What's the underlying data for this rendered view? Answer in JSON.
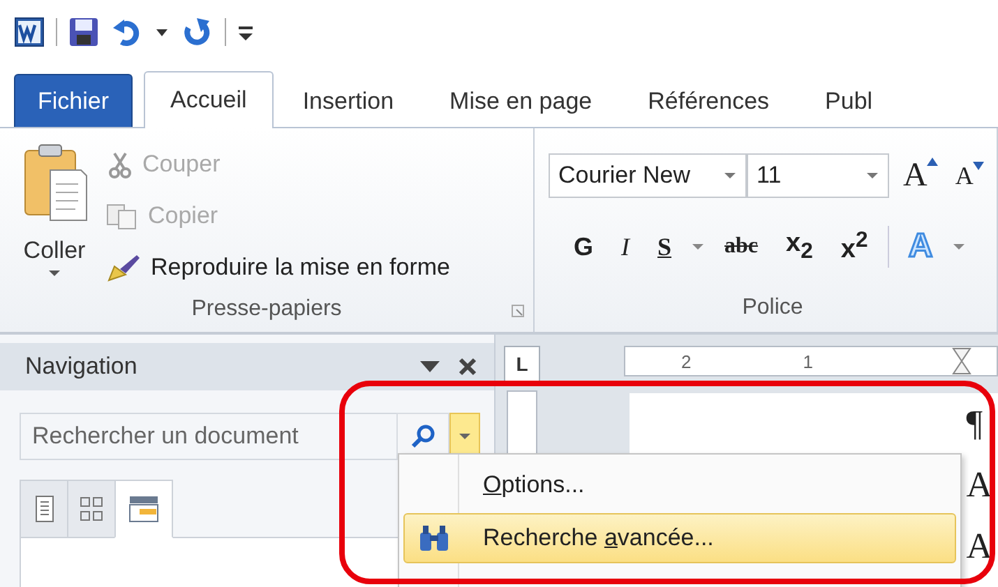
{
  "tabs": [
    {
      "label": "Fichier",
      "kind": "file",
      "selected": false
    },
    {
      "label": "Accueil",
      "kind": "tab",
      "selected": true
    },
    {
      "label": "Insertion",
      "kind": "tab",
      "selected": false
    },
    {
      "label": "Mise en page",
      "kind": "tab",
      "selected": false
    },
    {
      "label": "Références",
      "kind": "tab",
      "selected": false
    },
    {
      "label": "Publ",
      "kind": "tab",
      "selected": false
    }
  ],
  "clipboard": {
    "paste": "Coller",
    "cut": {
      "label": "Couper",
      "disabled": true
    },
    "copy": {
      "label": "Copier",
      "disabled": true
    },
    "format_painter": {
      "label": "Reproduire la mise en forme",
      "disabled": false
    },
    "group_label": "Presse-papiers"
  },
  "font": {
    "font_name": "Courier New",
    "font_size": "11",
    "grow": "A",
    "shrink": "A",
    "bold": "G",
    "italic": "I",
    "underline": "S",
    "strikethrough": "abc",
    "subscript": "x$_{2}$",
    "superscript": "x$^{2}$",
    "text_effects": "A",
    "group_label": "Police"
  },
  "navigation": {
    "title": "Navigation",
    "search": {
      "placeholder": "Rechercher un document"
    },
    "view_tabs": [
      {
        "kind": "headings",
        "selected": false
      },
      {
        "kind": "pages",
        "selected": false
      },
      {
        "kind": "results",
        "selected": true
      }
    ]
  },
  "ruler": {
    "corner": "L",
    "labels": [
      "2",
      "1"
    ]
  },
  "document": {
    "marks": [
      "¶",
      "A",
      "A"
    ]
  },
  "search_menu": {
    "items": [
      {
        "kind": "plain",
        "key": "O",
        "after": "ptions...",
        "selected": false
      },
      {
        "kind": "binoculars",
        "before": "Recherche ",
        "key": "a",
        "after": "vancée...",
        "selected": true
      }
    ]
  }
}
